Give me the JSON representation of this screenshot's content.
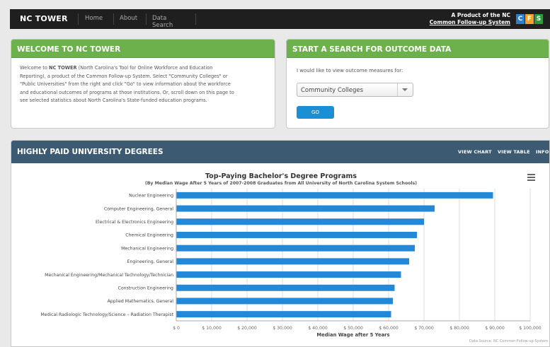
{
  "nav": {
    "brand": "NC TOWER",
    "items": [
      "Home",
      "About",
      "Data Search"
    ],
    "product_line1": "A Product of the NC",
    "product_line2": "Common Follow-up System",
    "logo_letters": [
      "C",
      "F",
      "S"
    ],
    "logo_colors": [
      "#2b7fd0",
      "#f0a22a",
      "#2b9a3a"
    ]
  },
  "welcome": {
    "title": "WELCOME TO NC TOWER",
    "lines": [
      [
        "Welcome to ",
        "NC TOWER",
        " (North Carolina's Tool for Online Workforce and Education"
      ],
      [
        "Reporting), a product of the Common Follow-up System. Select \"Community Colleges\" or"
      ],
      [
        "\"Public Universities\" from the right and click \"Go\" to view information about the workforce"
      ],
      [
        "and educational outcomes of programs at those institutions. Or, scroll down on this page to"
      ],
      [
        "see selected statistics about North Carolina's State-funded education programs."
      ]
    ]
  },
  "search": {
    "title": "START A SEARCH FOR OUTCOME DATA",
    "label": "I would like to view outcome measures for:",
    "selected": "Community Colleges",
    "go_label": "GO"
  },
  "degrees": {
    "title": "HIGHLY PAID UNIVERSITY DEGREES",
    "links": [
      "VIEW CHART",
      "VIEW TABLE",
      "INFO"
    ]
  },
  "colors": {
    "green": "#6cb14b",
    "navy": "#3d5a73",
    "bar": "#2388d6",
    "go": "#1b8fd6"
  },
  "chart_data": {
    "type": "bar",
    "orientation": "horizontal",
    "title": "Top-Paying Bachelor's Degree Programs",
    "subtitle": "(By Median Wage After 5 Years of 2007-2008 Graduates from All University of North Carolina System Schools)",
    "xlabel": "Median Wage after 5 Years",
    "source": "Data Source: NC Common Follow-up System",
    "xlim": [
      0,
      100000
    ],
    "ticks": [
      "$ 0",
      "$ 10,000",
      "$ 20,000",
      "$ 30,000",
      "$ 40,000",
      "$ 50,000",
      "$ 60,000",
      "$ 70,000",
      "$ 80,000",
      "$ 90,000",
      "$ 100,000"
    ],
    "grid": true,
    "categories": [
      "Nuclear Engineering",
      "Computer Engineering, General",
      "Electrical & Electronics Engineering",
      "Chemical Engineering",
      "Mechanical Engineering",
      "Engineering, General",
      "Mechanical Engineering/Mechanical Technology/Technician",
      "Construction Engineering",
      "Applied Mathematics, General",
      "Medical Radiologic Technology/Science – Radiation Therapist"
    ],
    "values": [
      89500,
      73000,
      70000,
      68000,
      67400,
      65800,
      63500,
      61700,
      61200,
      60700
    ]
  }
}
